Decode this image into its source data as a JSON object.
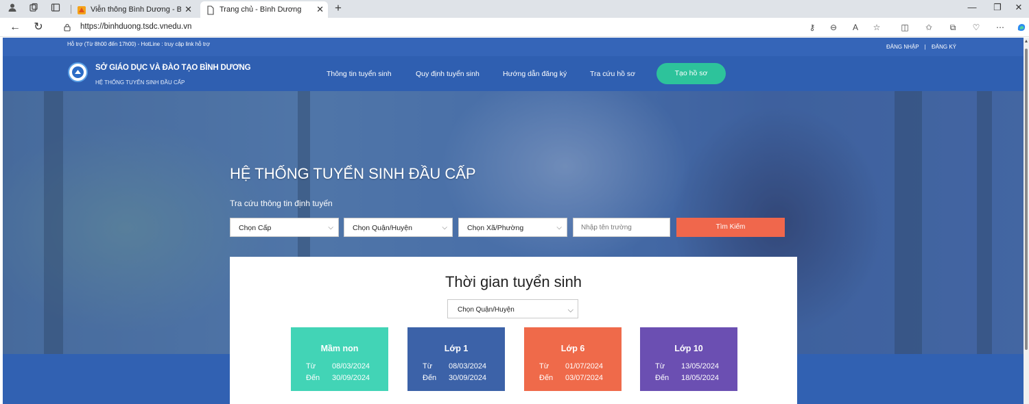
{
  "browser": {
    "tabs": [
      {
        "title": "Viễn thông Bình Dương - Bình Dương"
      },
      {
        "title": "Trang chủ - Bình Dương"
      }
    ],
    "url": "https://binhduong.tsdc.vnedu.vn"
  },
  "topbar": {
    "support": "Hỗ trợ (Từ 8h00 đến 17h00) - HotLine : truy cập link hỗ trợ",
    "login": "ĐĂNG NHẬP",
    "separator": "|",
    "register": "ĐĂNG KÝ"
  },
  "header": {
    "title": "SỞ GIÁO DỤC VÀ ĐÀO TẠO BÌNH DƯƠNG",
    "subtitle": "HỆ THỐNG TUYỂN SINH ĐẦU CẤP",
    "nav": [
      "Thông tin tuyển sinh",
      "Quy định tuyển sinh",
      "Hướng dẫn đăng ký",
      "Tra cứu hồ sơ"
    ],
    "cta": "Tạo hồ sơ",
    "cta_color": "#2dc39b"
  },
  "hero": {
    "title": "HỆ THỐNG TUYỂN SINH ĐẦU CẤP",
    "subtitle": "Tra cứu thông tin định tuyến",
    "select_level": "Chọn Cấp",
    "select_district": "Chọn Quận/Huyện",
    "select_ward": "Chọn Xã/Phường",
    "school_placeholder": "Nhập tên trường",
    "search_button": "Tìm Kiếm",
    "search_color": "#f0674c"
  },
  "schedule": {
    "title": "Thời gian tuyển sinh",
    "district_select": "Chọn Quận/Huyện",
    "from_label": "Từ",
    "to_label": "Đến",
    "levels": [
      {
        "name": "Mầm non",
        "from": "08/03/2024",
        "to": "30/09/2024",
        "color": "#42d4b6"
      },
      {
        "name": "Lớp 1",
        "from": "08/03/2024",
        "to": "30/09/2024",
        "color": "#3c62a8"
      },
      {
        "name": "Lớp 6",
        "from": "01/07/2024",
        "to": "03/07/2024",
        "color": "#ef6a4a"
      },
      {
        "name": "Lớp 10",
        "from": "13/05/2024",
        "to": "18/05/2024",
        "color": "#6b4fb2"
      }
    ]
  }
}
